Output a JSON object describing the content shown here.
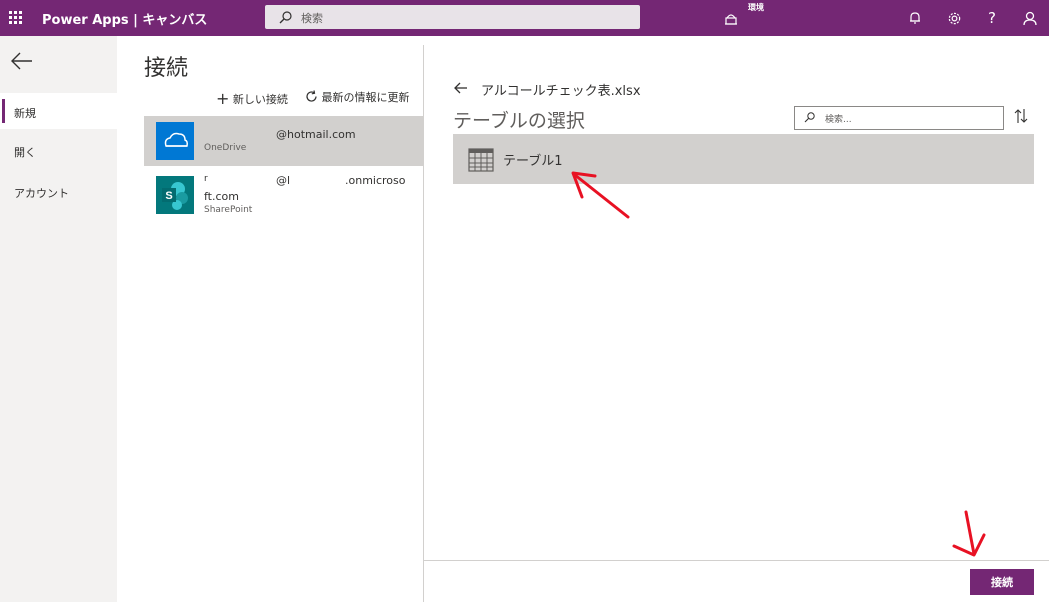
{
  "header": {
    "app_name": "Power Apps | キャンバス",
    "search_placeholder": "検索",
    "environment_label": "環境",
    "icons": [
      "waffle-icon",
      "environment-icon",
      "bell-icon",
      "gear-icon",
      "help-icon",
      "person-icon"
    ]
  },
  "leftnav": {
    "items": [
      {
        "label": "新規",
        "selected": true
      },
      {
        "label": "開く",
        "selected": false
      },
      {
        "label": "アカウント",
        "selected": false
      }
    ]
  },
  "connections": {
    "title": "接続",
    "new_connection": "新しい接続",
    "refresh": "最新の情報に更新",
    "items": [
      {
        "email": "@hotmail.com",
        "service": "OneDrive",
        "selected": true
      },
      {
        "email_prefix": "r",
        "email_middle": "@l",
        "email_suffix": ".onmicroso",
        "email_line2": "ft.com",
        "service": "SharePoint",
        "selected": false
      }
    ]
  },
  "right": {
    "file_name": "アルコールチェック表.xlsx",
    "title": "テーブルの選択",
    "search_placeholder": "検索...",
    "tables": [
      {
        "name": "テーブル1"
      }
    ],
    "connect_button": "接続"
  },
  "colors": {
    "brand": "#742774",
    "selected_row": "#d2d0ce",
    "onedrive_tile": "#0078d4",
    "sharepoint_tile": "#03787c",
    "annotation_arrow": "#e81123"
  }
}
